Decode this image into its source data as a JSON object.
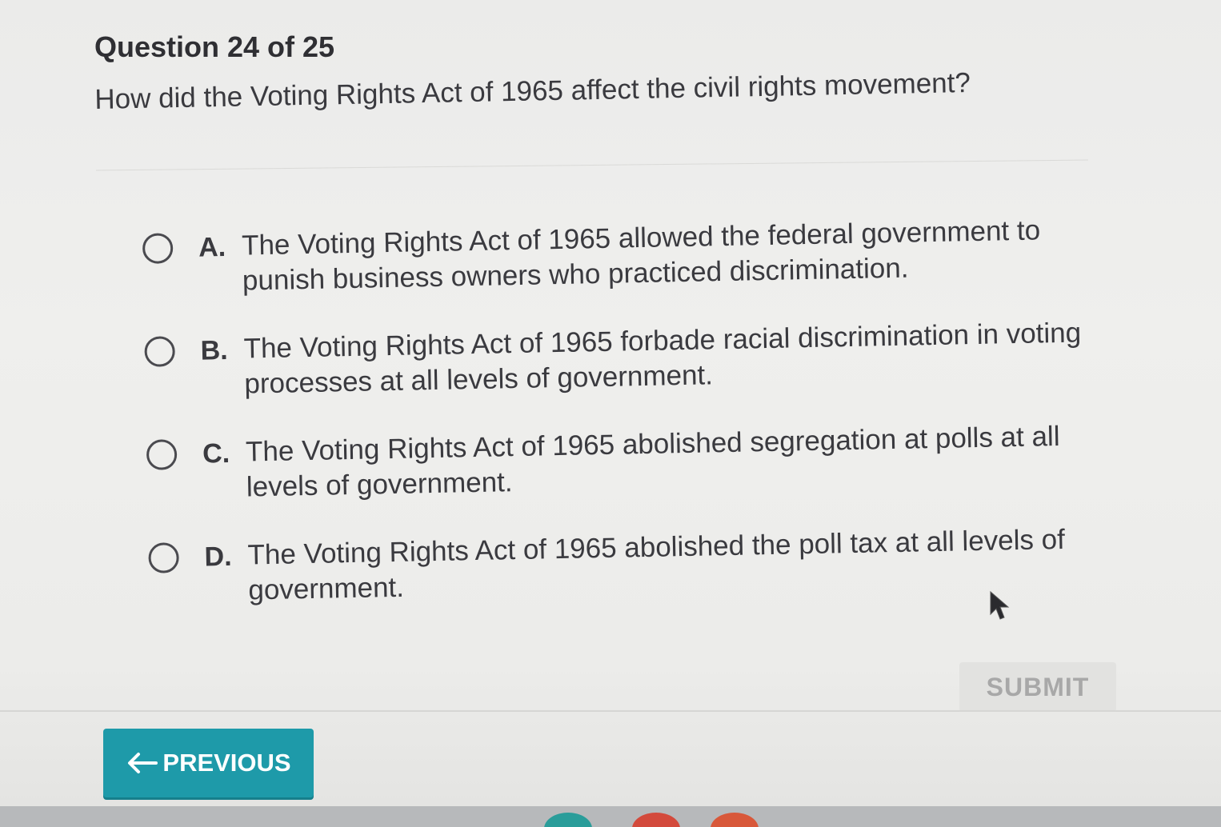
{
  "question": {
    "header": "Question 24 of 25",
    "prompt": "How did the Voting Rights Act of 1965 affect the civil rights movement?"
  },
  "options": [
    {
      "letter": "A.",
      "text": "The Voting Rights Act of 1965 allowed the federal government to punish business owners who practiced discrimination."
    },
    {
      "letter": "B.",
      "text": "The Voting Rights Act of 1965 forbade racial discrimination in voting processes at all levels of government."
    },
    {
      "letter": "C.",
      "text": "The Voting Rights Act of 1965 abolished segregation at polls at all levels of government."
    },
    {
      "letter": "D.",
      "text": "The Voting Rights Act of 1965 abolished the poll tax at all levels of government."
    }
  ],
  "actions": {
    "submit_label": "SUBMIT",
    "previous_label": "PREVIOUS"
  },
  "colors": {
    "previous_bg": "#1e9aa9",
    "submit_bg": "#e2e2e0",
    "text": "#3a3a3f"
  },
  "icons": {
    "previous": "arrow-left-icon",
    "pointer": "mouse-cursor-icon",
    "radio": "radio-circle-icon"
  }
}
